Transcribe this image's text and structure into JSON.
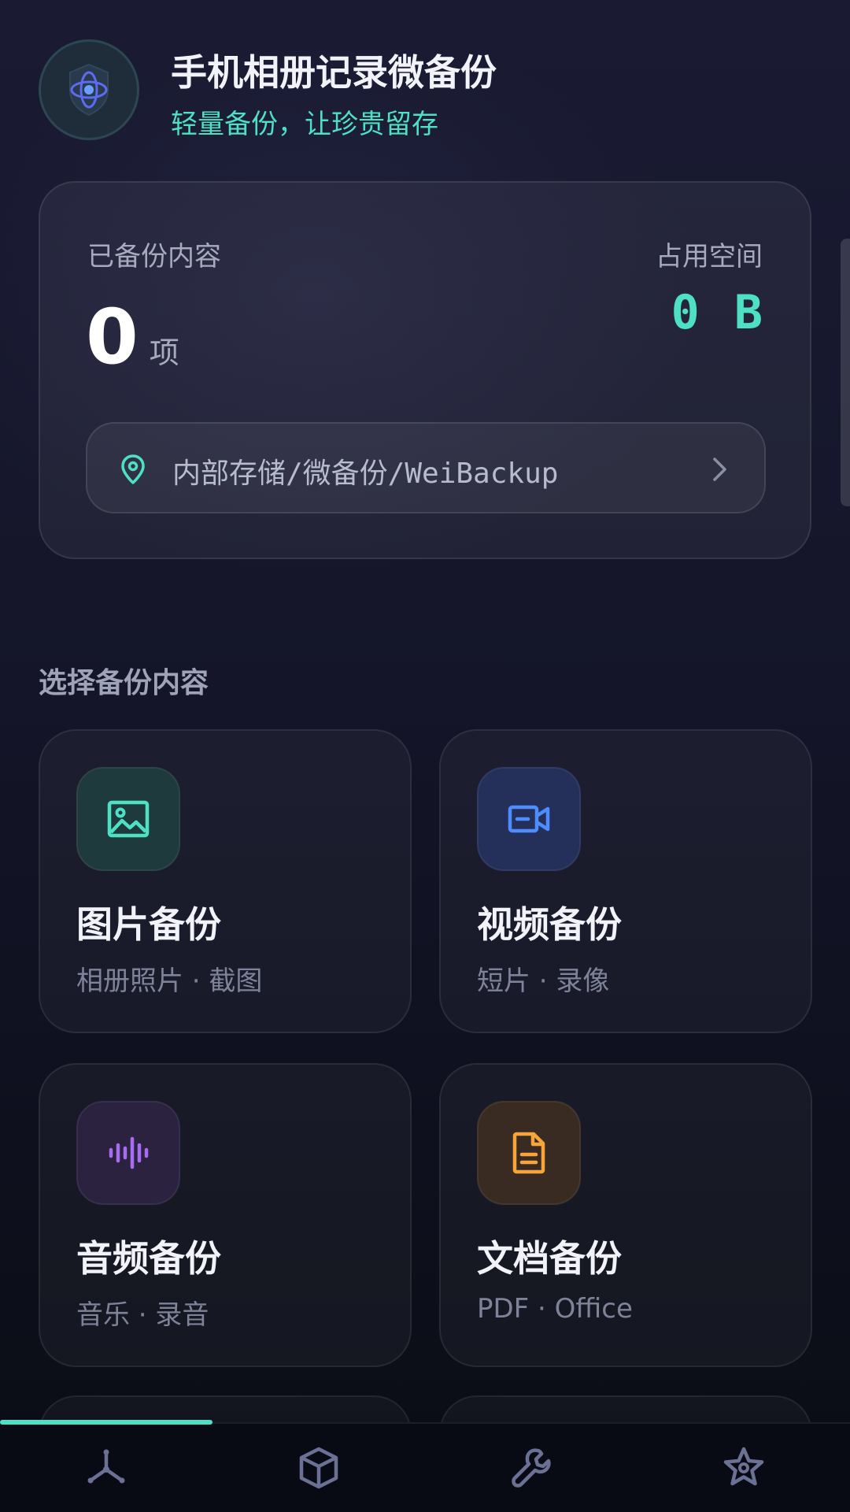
{
  "header": {
    "title": "手机相册记录微备份",
    "subtitle": "轻量备份，让珍贵留存"
  },
  "stats": {
    "backed_label": "已备份内容",
    "count": "0",
    "count_unit": "项",
    "space_label": "占用空间",
    "space_value": "0 B",
    "path": "内部存储/微备份/WeiBackup"
  },
  "section": {
    "title": "选择备份内容"
  },
  "categories": [
    {
      "name": "图片备份",
      "desc": "相册照片 · 截图",
      "icon": "image-icon",
      "color": "#4ee0c4"
    },
    {
      "name": "视频备份",
      "desc": "短片 · 录像",
      "icon": "video-icon",
      "color": "#4d8dff"
    },
    {
      "name": "音频备份",
      "desc": "音乐 · 录音",
      "icon": "audio-icon",
      "color": "#a76cf2"
    },
    {
      "name": "文档备份",
      "desc": "PDF · Office",
      "icon": "document-icon",
      "color": "#f7a43c"
    }
  ],
  "nav": {
    "items": [
      {
        "icon": "hub-icon",
        "active": true
      },
      {
        "icon": "cube-icon",
        "active": false
      },
      {
        "icon": "wrench-icon",
        "active": false
      },
      {
        "icon": "star-icon",
        "active": false
      }
    ],
    "accent": "#4ee0c4"
  }
}
